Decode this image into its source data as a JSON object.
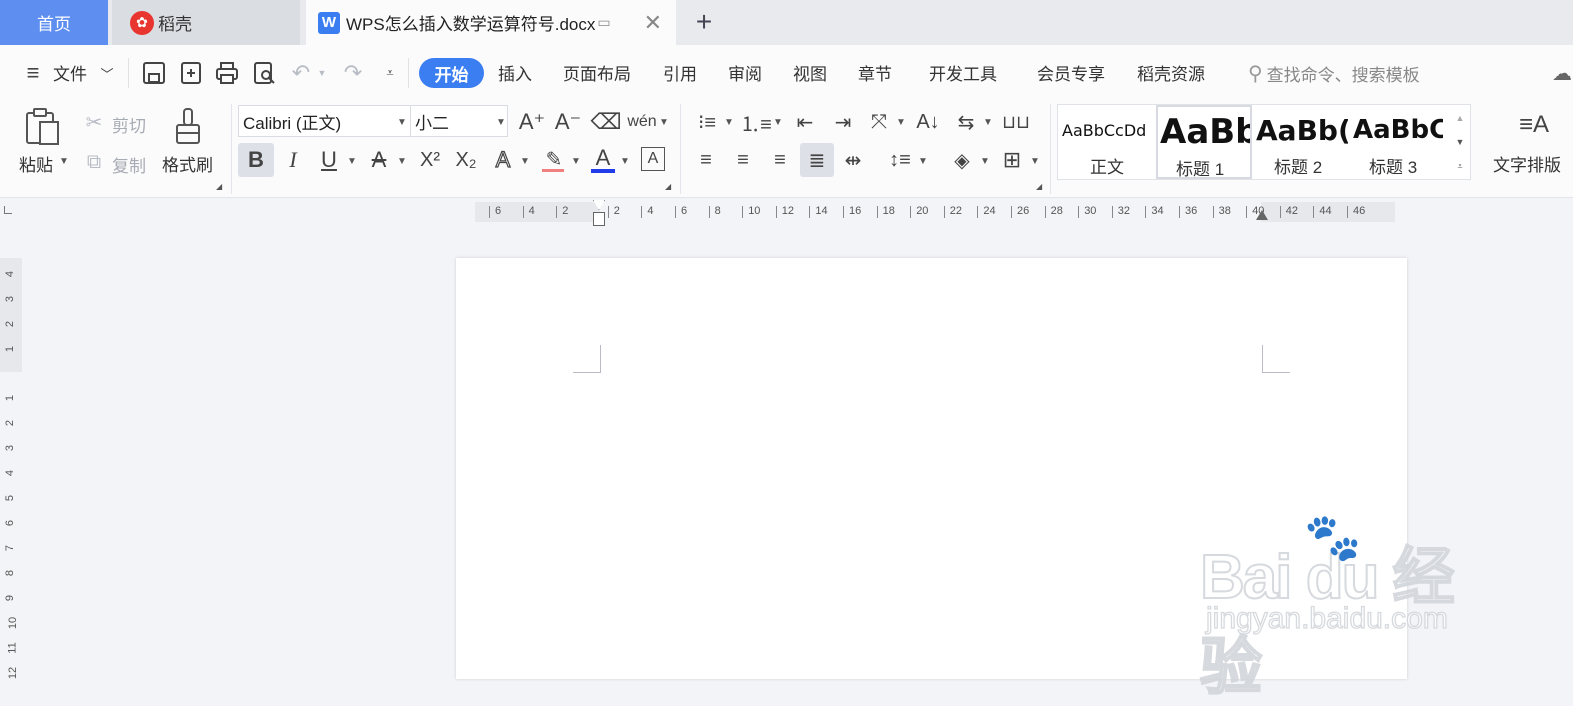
{
  "tabs": {
    "home": "首页",
    "daoke": "稻壳",
    "doc": "WPS怎么插入数学运算符号.docx"
  },
  "menu": {
    "file": "文件",
    "items": [
      "开始",
      "插入",
      "页面布局",
      "引用",
      "审阅",
      "视图",
      "章节",
      "开发工具",
      "会员专享",
      "稻壳资源"
    ],
    "search_placeholder": "查找命令、搜索模板"
  },
  "ribbon": {
    "paste": "粘贴",
    "cut": "剪切",
    "copy": "复制",
    "format_painter": "格式刷",
    "font_name": "Calibri (正文)",
    "font_size": "小二",
    "text_layout": "文字排版",
    "styles": [
      {
        "preview": "AaBbCcDd",
        "name": "正文"
      },
      {
        "preview": "AaBb",
        "name": "标题 1"
      },
      {
        "preview": "AaBb(",
        "name": "标题 2"
      },
      {
        "preview": "AaBbC",
        "name": "标题 3"
      }
    ]
  },
  "ruler": {
    "h_labels": [
      "6",
      "4",
      "2",
      "2",
      "4",
      "6",
      "8",
      "10",
      "12",
      "14",
      "16",
      "18",
      "20",
      "22",
      "24",
      "26",
      "28",
      "30",
      "32",
      "34",
      "36",
      "38",
      "40",
      "42",
      "44",
      "46"
    ],
    "v_labels": [
      "4",
      "3",
      "2",
      "1",
      "1",
      "2",
      "3",
      "4",
      "5",
      "6",
      "7",
      "8",
      "9",
      "10",
      "11",
      "12"
    ]
  },
  "watermark": {
    "brand": "Bai du 经验",
    "url": "jingyan.baidu.com"
  },
  "colors": {
    "accent": "#3b7ef1",
    "home_tab": "#5e8ff0",
    "font_color_underline": "#1f3ce8",
    "highlight_underline": "#f08080"
  }
}
